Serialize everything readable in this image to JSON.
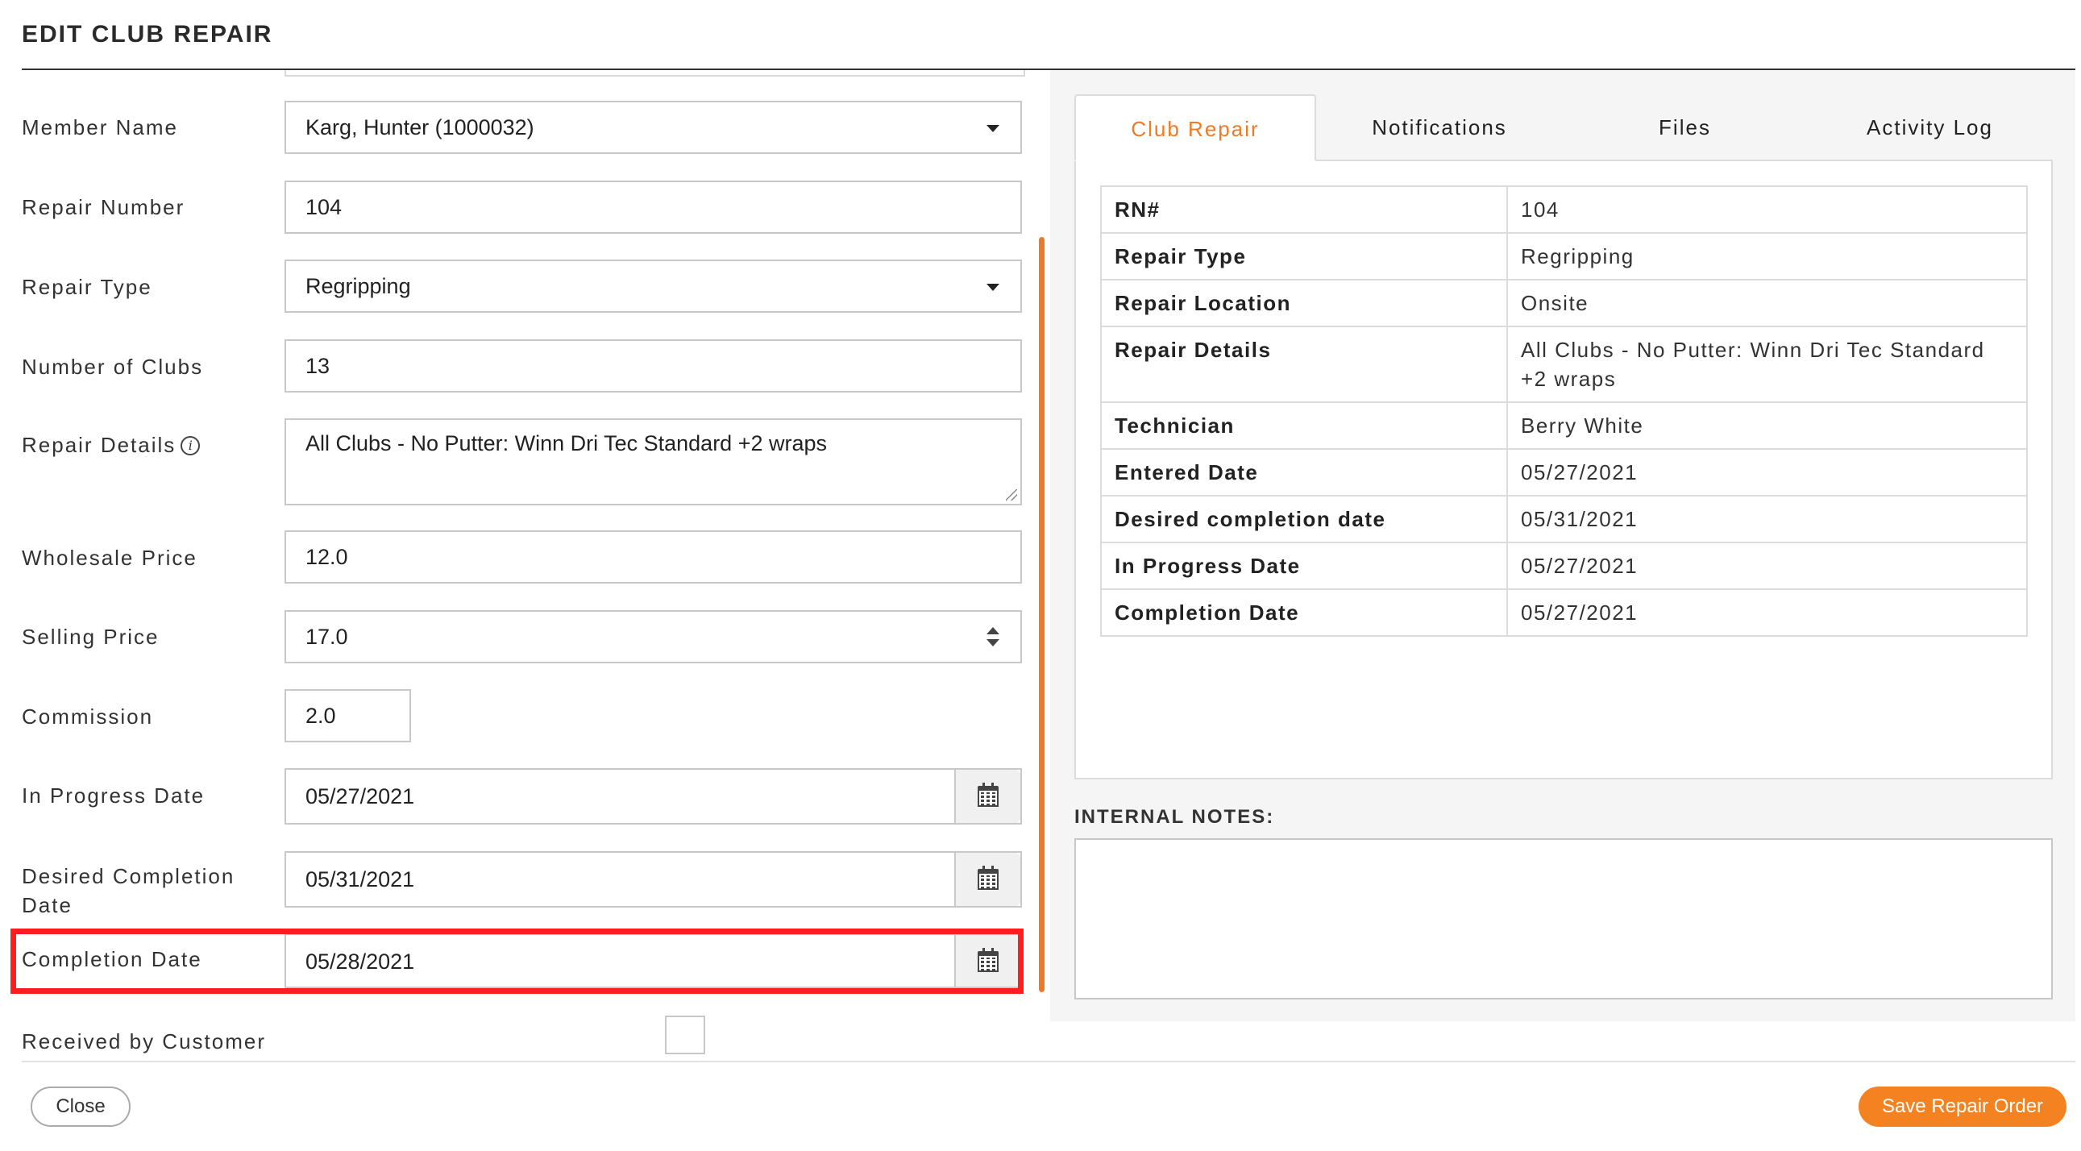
{
  "dialog": {
    "title": "EDIT CLUB REPAIR"
  },
  "form": {
    "member_name": {
      "label": "Member Name",
      "value": "Karg, Hunter (1000032)"
    },
    "repair_number": {
      "label": "Repair Number",
      "value": "104"
    },
    "repair_type": {
      "label": "Repair Type",
      "value": "Regripping"
    },
    "number_of_clubs": {
      "label": "Number of Clubs",
      "value": "13"
    },
    "repair_details": {
      "label": "Repair Details",
      "info_glyph": "i",
      "value": "All Clubs - No Putter: Winn Dri Tec Standard +2 wraps"
    },
    "wholesale_price": {
      "label": "Wholesale Price",
      "value": "12.0"
    },
    "selling_price": {
      "label": "Selling Price",
      "value": "17.0"
    },
    "commission": {
      "label": "Commission",
      "value": "2.0"
    },
    "in_progress_date": {
      "label": "In Progress Date",
      "value": "05/27/2021"
    },
    "desired_completion_date": {
      "label_line1": "Desired Completion",
      "label_line2": "Date",
      "value": "05/31/2021"
    },
    "completion_date": {
      "label": "Completion Date",
      "value": "05/28/2021"
    },
    "received_by_customer": {
      "label": "Received by Customer",
      "checked": false
    }
  },
  "tabs": [
    {
      "label": "Club Repair",
      "active": true
    },
    {
      "label": "Notifications",
      "active": false
    },
    {
      "label": "Files",
      "active": false
    },
    {
      "label": "Activity Log",
      "active": false
    }
  ],
  "summary": [
    {
      "key": "RN#",
      "value": "104"
    },
    {
      "key": "Repair Type",
      "value": "Regripping"
    },
    {
      "key": "Repair Location",
      "value": "Onsite"
    },
    {
      "key": "Repair Details",
      "value": "All Clubs - No Putter: Winn Dri Tec Standard +2 wraps"
    },
    {
      "key": "Technician",
      "value": "Berry White"
    },
    {
      "key": "Entered Date",
      "value": "05/27/2021"
    },
    {
      "key": "Desired completion date",
      "value": "05/31/2021"
    },
    {
      "key": "In Progress Date",
      "value": "05/27/2021"
    },
    {
      "key": "Completion Date",
      "value": "05/27/2021"
    }
  ],
  "internal_notes": {
    "label": "INTERNAL NOTES:",
    "value": ""
  },
  "footer": {
    "close_label": "Close",
    "save_label": "Save Repair Order"
  },
  "colors": {
    "accent": "#f58220",
    "highlight": "#ff1d1d",
    "border": "#c8c8c8"
  },
  "icons": {
    "dropdown": "chevron-down-icon",
    "calendar": "calendar-icon",
    "info": "info-icon",
    "spinner": "number-spinner-icon"
  }
}
